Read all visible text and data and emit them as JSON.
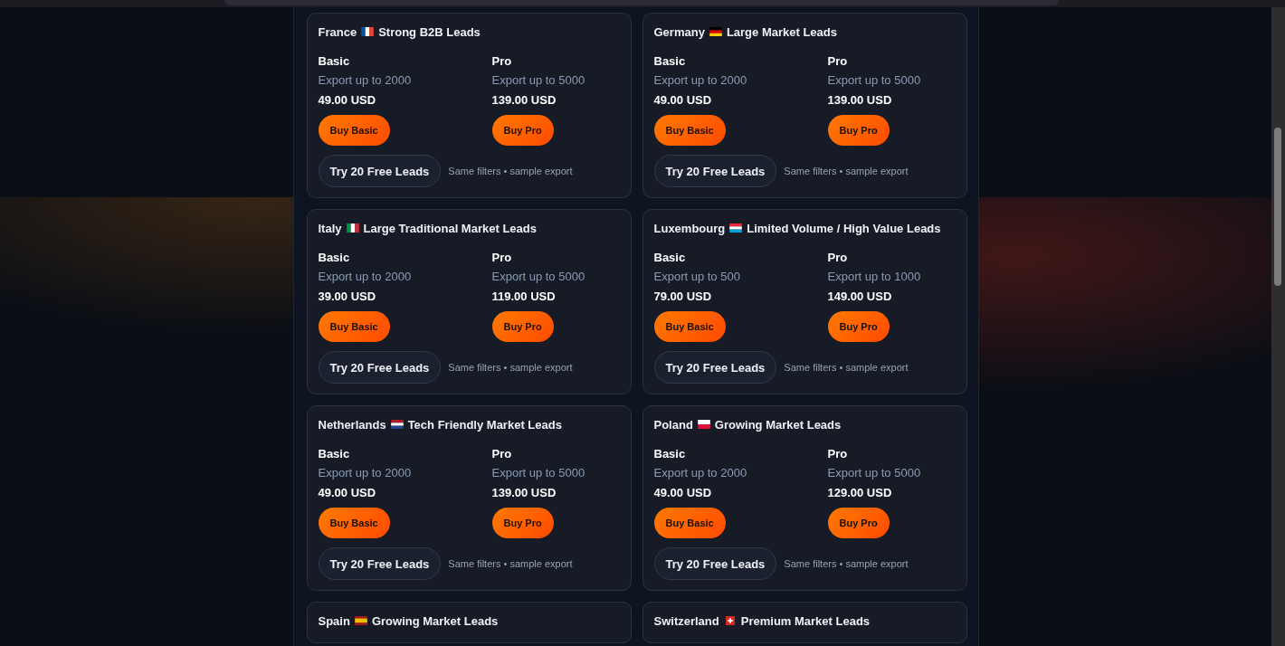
{
  "cards": [
    {
      "country": "France",
      "kind": "france",
      "headline": "Strong B2B Leads",
      "plans": [
        {
          "name": "Basic",
          "export": "Export up to 2000",
          "price": "49.00 USD",
          "button": "Buy Basic"
        },
        {
          "name": "Pro",
          "export": "Export up to 5000",
          "price": "139.00 USD",
          "button": "Buy Pro"
        }
      ],
      "trial": {
        "button": "Try 20 Free Leads",
        "note": "Same filters • sample export"
      }
    },
    {
      "country": "Germany",
      "kind": "germany",
      "headline": "Large Market Leads",
      "plans": [
        {
          "name": "Basic",
          "export": "Export up to 2000",
          "price": "49.00 USD",
          "button": "Buy Basic"
        },
        {
          "name": "Pro",
          "export": "Export up to 5000",
          "price": "139.00 USD",
          "button": "Buy Pro"
        }
      ],
      "trial": {
        "button": "Try 20 Free Leads",
        "note": "Same filters • sample export"
      }
    },
    {
      "country": "Italy",
      "kind": "italy",
      "headline": "Large Traditional Market Leads",
      "plans": [
        {
          "name": "Basic",
          "export": "Export up to 2000",
          "price": "39.00 USD",
          "button": "Buy Basic"
        },
        {
          "name": "Pro",
          "export": "Export up to 5000",
          "price": "119.00 USD",
          "button": "Buy Pro"
        }
      ],
      "trial": {
        "button": "Try 20 Free Leads",
        "note": "Same filters • sample export"
      }
    },
    {
      "country": "Luxembourg",
      "kind": "luxembourg",
      "headline": "Limited Volume / High Value Leads",
      "plans": [
        {
          "name": "Basic",
          "export": "Export up to 500",
          "price": "79.00 USD",
          "button": "Buy Basic"
        },
        {
          "name": "Pro",
          "export": "Export up to 1000",
          "price": "149.00 USD",
          "button": "Buy Pro"
        }
      ],
      "trial": {
        "button": "Try 20 Free Leads",
        "note": "Same filters • sample export"
      }
    },
    {
      "country": "Netherlands",
      "kind": "netherlands",
      "headline": "Tech Friendly Market Leads",
      "plans": [
        {
          "name": "Basic",
          "export": "Export up to 2000",
          "price": "49.00 USD",
          "button": "Buy Basic"
        },
        {
          "name": "Pro",
          "export": "Export up to 5000",
          "price": "139.00 USD",
          "button": "Buy Pro"
        }
      ],
      "trial": {
        "button": "Try 20 Free Leads",
        "note": "Same filters • sample export"
      }
    },
    {
      "country": "Poland",
      "kind": "poland",
      "headline": "Growing Market Leads",
      "plans": [
        {
          "name": "Basic",
          "export": "Export up to 2000",
          "price": "49.00 USD",
          "button": "Buy Basic"
        },
        {
          "name": "Pro",
          "export": "Export up to 5000",
          "price": "129.00 USD",
          "button": "Buy Pro"
        }
      ],
      "trial": {
        "button": "Try 20 Free Leads",
        "note": "Same filters • sample export"
      }
    },
    {
      "country": "Spain",
      "kind": "spain",
      "headline": "Growing Market Leads"
    },
    {
      "country": "Switzerland",
      "kind": "switzerland",
      "headline": "Premium Market Leads"
    }
  ]
}
